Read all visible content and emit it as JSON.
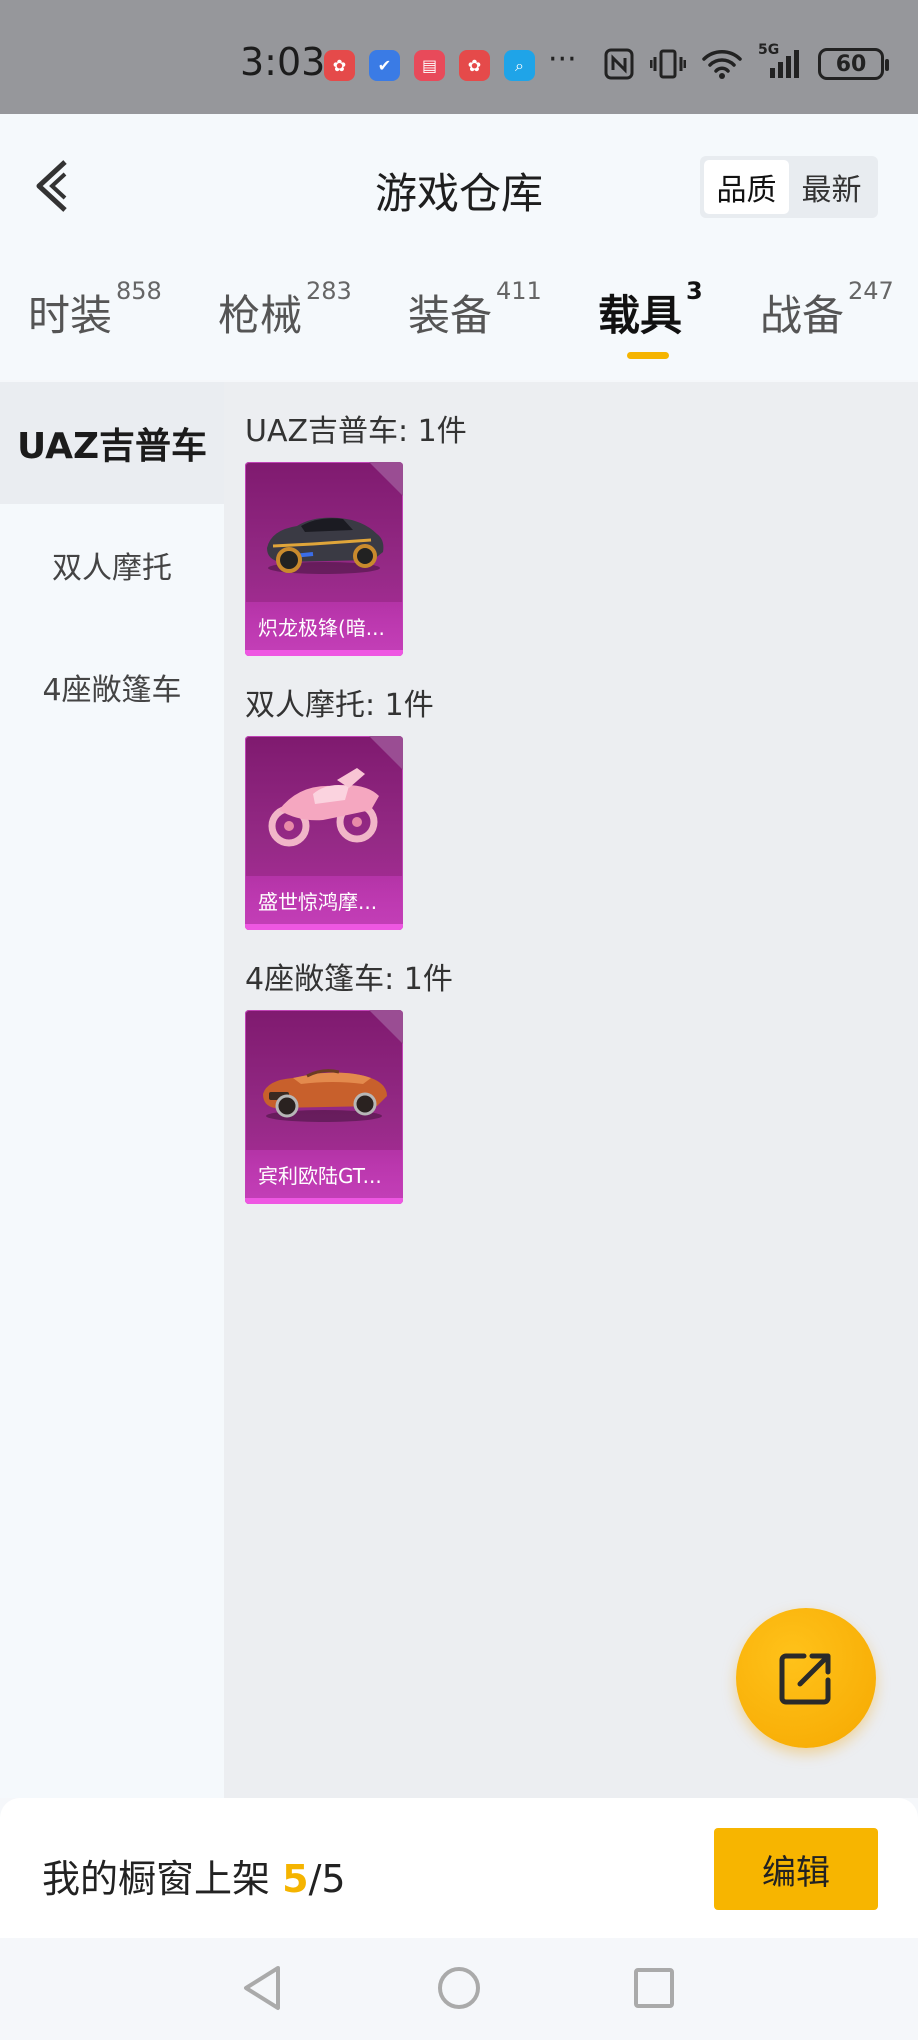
{
  "status_bar": {
    "time": "3:03",
    "battery": "60",
    "more": "···",
    "network": "5G"
  },
  "header": {
    "title": "游戏仓库",
    "sort_options": [
      "品质",
      "最新"
    ],
    "sort_selected": "品质"
  },
  "tabs": [
    {
      "label": "时装",
      "count": "858"
    },
    {
      "label": "枪械",
      "count": "283"
    },
    {
      "label": "装备",
      "count": "411"
    },
    {
      "label": "载具",
      "count": "3",
      "active": true
    },
    {
      "label": "战备",
      "count": "247"
    }
  ],
  "sidebar": {
    "items": [
      {
        "label": "UAZ吉普车",
        "active": true
      },
      {
        "label": "双人摩托"
      },
      {
        "label": "4座敞篷车"
      }
    ]
  },
  "groups": [
    {
      "title": "UAZ吉普车: 1件",
      "items": [
        {
          "name": "炽龙极锋(暗...",
          "art": "dark-sports-car"
        }
      ]
    },
    {
      "title": "双人摩托: 1件",
      "items": [
        {
          "name": "盛世惊鸿摩...",
          "art": "pink-motorcycle"
        }
      ]
    },
    {
      "title": "4座敞篷车: 1件",
      "items": [
        {
          "name": "宾利欧陆GT...",
          "art": "orange-convertible"
        }
      ]
    }
  ],
  "bottom": {
    "showcase_label": "我的橱窗上架",
    "current": "5",
    "separator_total": "/5",
    "edit_label": "编辑"
  },
  "colors": {
    "accent": "#f5b400",
    "card_purple": "#952a86"
  }
}
